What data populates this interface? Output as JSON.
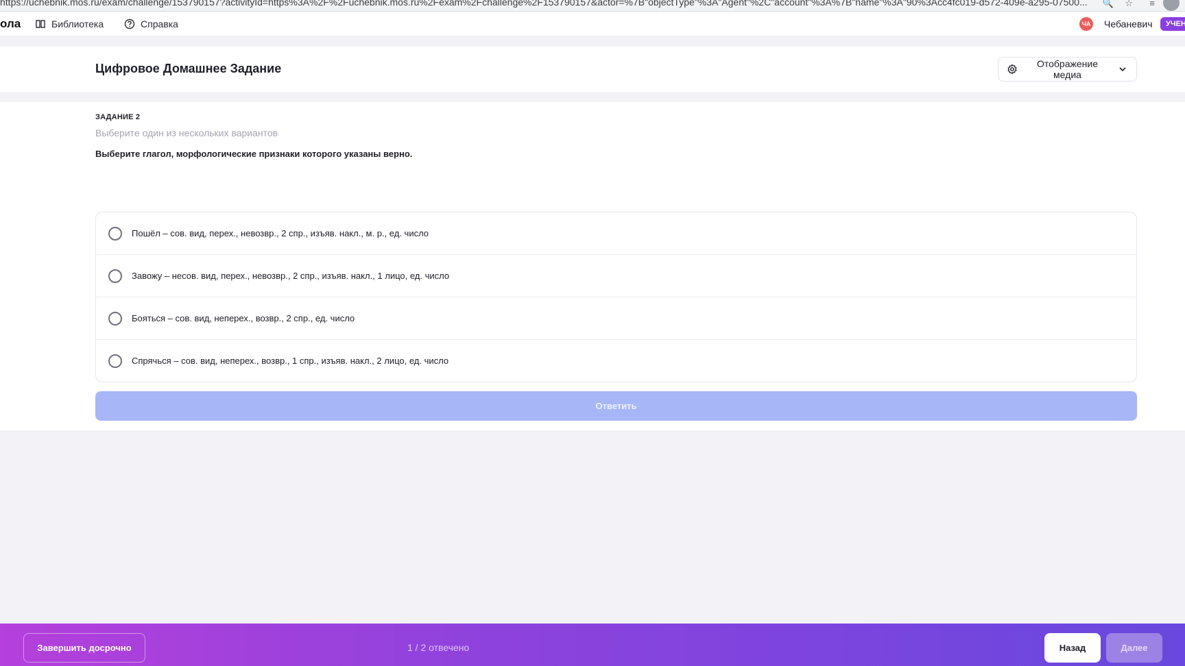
{
  "browser": {
    "url": "https://uchebnik.mos.ru/exam/challenge/153790157?activityId=https%3A%2F%2Fuchebnik.mos.ru%2Fexam%2Fchallenge%2F153790157&actor=%7B\"objectType\"%3A\"Agent\"%2C\"account\"%3A%7B\"name\"%3A\"90%3Acc4fc019-d572-409e-a295-07500..."
  },
  "nav": {
    "brand": "ола",
    "items": [
      {
        "label": "Библиотека",
        "icon": "book-icon"
      },
      {
        "label": "Справка",
        "icon": "help-icon"
      }
    ],
    "avatar_initials": "ЧА",
    "avatar_color": "#ec5c5c",
    "user_name": "Чебаневич",
    "role_badge": "УЧЕН"
  },
  "header": {
    "title": "Цифровое Домашнее Задание",
    "media_button": "Отображение медиа"
  },
  "task": {
    "number_label": "ЗАДАНИЕ 2",
    "hint": "Выберите один из нескольких вариантов",
    "question": "Выберите глагол, морфологические признаки которого указаны верно.",
    "options": [
      "Пошёл – сов. вид, перех., невозвр., 2 спр., изъяв. накл., м. р., ед. число",
      "Завожу – несов. вид, перех., невозвр., 2 спр., изъяв. накл., 1 лицо, ед. число",
      "Бояться – сов. вид, неперех., возвр., 2 спр., ед. число",
      "Спрячься – сов. вид, неперех., возвр., 1 спр., изъяв. накл., 2 лицо, ед. число"
    ],
    "answer_button": "Ответить"
  },
  "footer": {
    "finish_button": "Завершить досрочно",
    "progress": "1 / 2 отвечено",
    "back_button": "Назад",
    "next_button": "Далее"
  },
  "colors": {
    "accent": "#8b3fe0",
    "answer_disabled": "#a6b6f6",
    "footer_start": "#b540db",
    "footer_end": "#6848de"
  }
}
